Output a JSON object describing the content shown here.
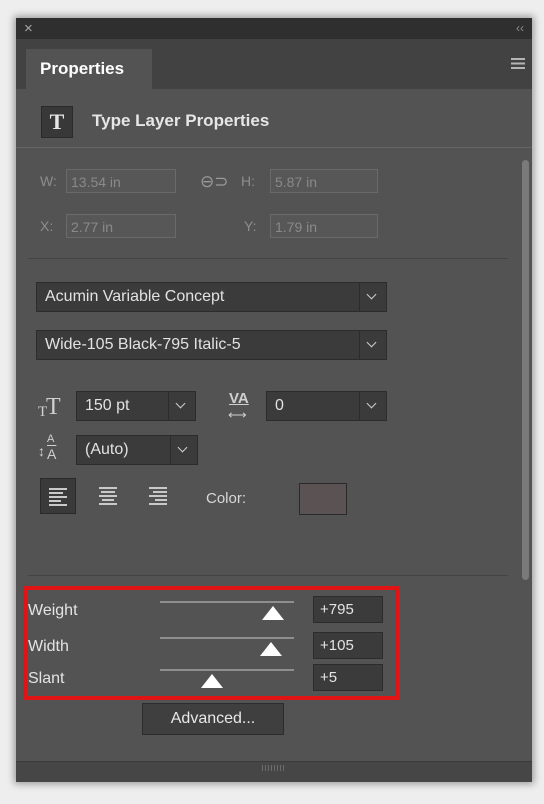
{
  "window": {
    "close_glyph": "×",
    "collapse_glyph": "‹‹"
  },
  "panel": {
    "tab_label": "Properties",
    "header_icon_glyph": "T",
    "header_title": "Type Layer Properties"
  },
  "transform": {
    "w_label": "W:",
    "w_value": "13.54 in",
    "h_label": "H:",
    "h_value": "5.87 in",
    "x_label": "X:",
    "x_value": "2.77 in",
    "y_label": "Y:",
    "y_value": "1.79 in",
    "link_glyph": "⊖⊃"
  },
  "character": {
    "font_family": "Acumin Variable Concept",
    "font_style": "Wide-105 Black-795 Italic-5",
    "font_size": "150 pt",
    "tracking": "0",
    "leading": "(Auto)",
    "color_label": "Color:",
    "color_swatch": "#5b5353"
  },
  "paragraph": {
    "align_options": [
      "left",
      "center",
      "right"
    ],
    "selected_align": "left"
  },
  "variable": {
    "axes": [
      {
        "label": "Weight",
        "value": "+795",
        "fraction": 0.84
      },
      {
        "label": "Width",
        "value": "+105",
        "fraction": 0.83
      },
      {
        "label": "Slant",
        "value": "+5",
        "fraction": 0.39
      }
    ],
    "highlight_color": "#e01414"
  },
  "actions": {
    "advanced_label": "Advanced..."
  }
}
